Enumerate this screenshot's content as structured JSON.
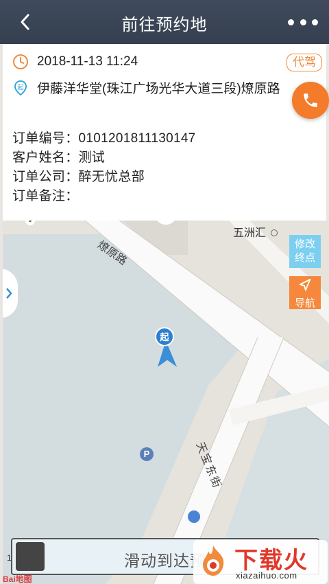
{
  "header": {
    "title": "前往预约地"
  },
  "order": {
    "time": "2018-11-13 11:24",
    "badge": "代驾",
    "address": "伊藤洋华堂(珠江广场光华大道三段)燎原路",
    "start_marker": "起",
    "order_no": "订单编号：0101201811130147",
    "customer": "客户姓名：测试",
    "company": "订单公司：醉无忧总部",
    "remark": "订单备注："
  },
  "map": {
    "road_liaoyuan": "燎原路",
    "poi_wuzhouhui": "五洲汇",
    "road_tianbao": "天宝东街",
    "modify_dest": [
      "修改",
      "终点"
    ],
    "navigate": "导航",
    "parking": "P",
    "pin_label": "起",
    "scale": "10",
    "logo": "Bai地图"
  },
  "slider": {
    "label": "滑动到达预"
  },
  "watermark": {
    "brand": "下载火",
    "domain": "xiazaihuo.com"
  },
  "colors": {
    "accent": "#f47b2a",
    "header": "#3a4556",
    "modify": "#7dcff0",
    "nav": "#f5883c"
  }
}
